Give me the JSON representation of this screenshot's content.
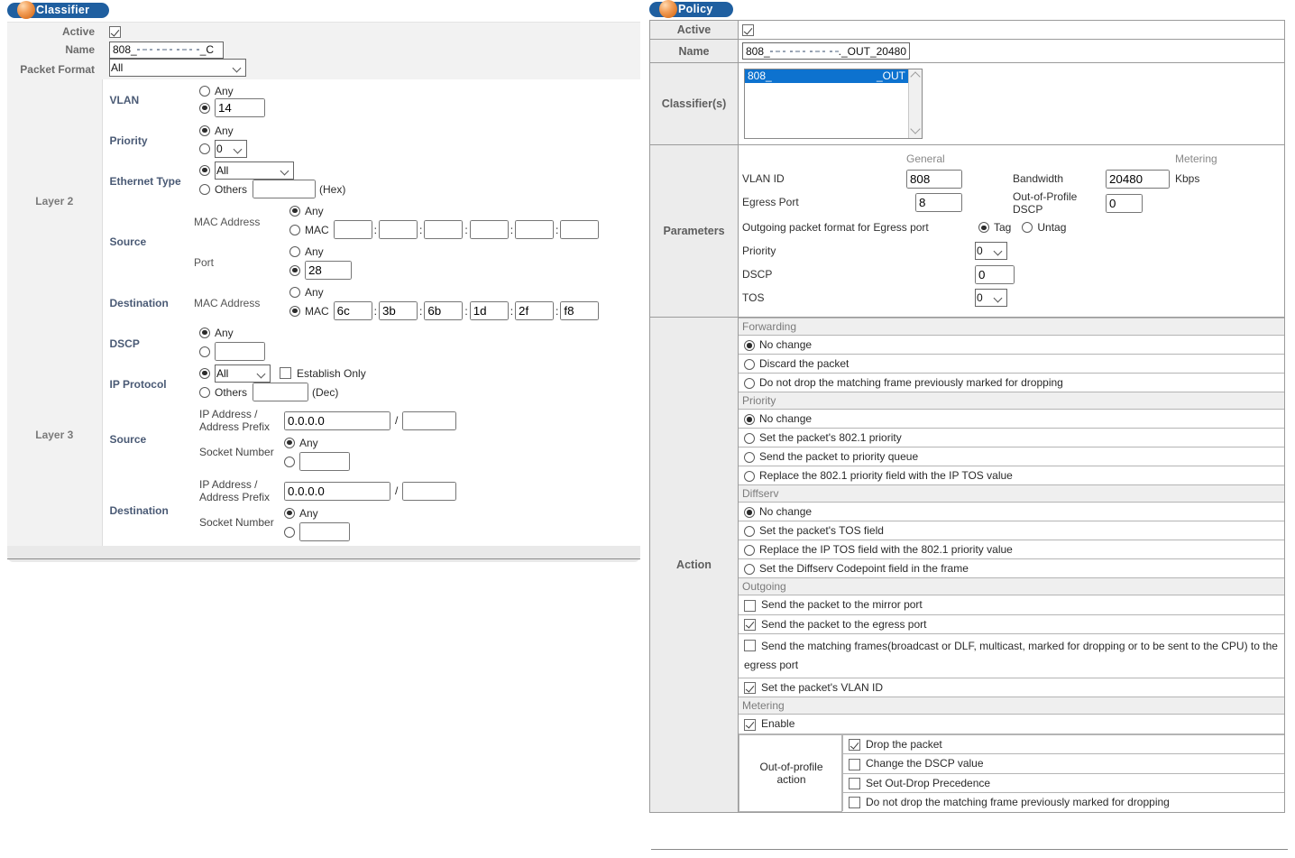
{
  "classifier": {
    "title": "Classifier",
    "active_label": "Active",
    "active_checked": true,
    "name_label": "Name",
    "name_prefix": "808_",
    "name_suffix": "_C",
    "packet_format_label": "Packet Format",
    "packet_format_value": "All",
    "layer2_label": "Layer 2",
    "layer3_label": "Layer 3",
    "vlan_label": "VLAN",
    "vlan_any_label": "Any",
    "vlan_value": "14",
    "priority_label": "Priority",
    "priority_any_label": "Any",
    "priority_value": "0",
    "ethertype_label": "Ethernet Type",
    "ethertype_value": "All",
    "others_label": "Others",
    "hex_note": "(Hex)",
    "dec_note": "(Dec)",
    "source_label": "Source",
    "destination_label": "Destination",
    "mac_address_label": "MAC Address",
    "mac_label": "MAC",
    "any_label": "Any",
    "port_label": "Port",
    "src_port_value": "28",
    "dst_mac": [
      "6c",
      "3b",
      "6b",
      "1d",
      "2f",
      "f8"
    ],
    "src_mac": [
      "",
      "",
      "",
      "",
      "",
      ""
    ],
    "dscp_label": "DSCP",
    "dscp_value": "",
    "ip_protocol_label": "IP Protocol",
    "ip_protocol_value": "All",
    "establish_only_label": "Establish Only",
    "ip_proto_others_value": "",
    "ip_addr_label": "IP Address /",
    "addr_prefix_label": "Address Prefix",
    "src_ip": "0.0.0.0",
    "src_prefix": "",
    "dst_ip": "0.0.0.0",
    "dst_prefix": "",
    "socket_number_label": "Socket Number",
    "src_socket": "",
    "dst_socket": ""
  },
  "policy": {
    "title": "Policy",
    "active_label": "Active",
    "active_checked": true,
    "name_label": "Name",
    "name_prefix": "808_",
    "name_suffix": "._OUT_20480",
    "classifiers_label": "Classifier(s)",
    "classifier_option_prefix": "808_",
    "classifier_option_suffix": "_OUT",
    "parameters_label": "Parameters",
    "general_header": "General",
    "metering_header": "Metering",
    "vlan_id_label": "VLAN ID",
    "vlan_id_value": "808",
    "egress_port_label": "Egress Port",
    "egress_port_value": "8",
    "bandwidth_label": "Bandwidth",
    "bandwidth_value": "20480",
    "bandwidth_unit": "Kbps",
    "oop_dscp_label_1": "Out-of-Profile",
    "oop_dscp_label_2": "DSCP",
    "oop_dscp_value": "0",
    "outgoing_format_label": "Outgoing packet format for Egress port",
    "tag_label": "Tag",
    "untag_label": "Untag",
    "priority_label": "Priority",
    "priority_value": "0",
    "dscp_label": "DSCP",
    "dscp_value": "0",
    "tos_label": "TOS",
    "tos_value": "0",
    "action_label": "Action",
    "groups": {
      "forwarding": "Forwarding",
      "priority": "Priority",
      "diffserv": "Diffserv",
      "outgoing": "Outgoing",
      "metering": "Metering"
    },
    "forwarding_options": [
      {
        "label": "No change",
        "selected": true
      },
      {
        "label": "Discard the packet",
        "selected": false
      },
      {
        "label": "Do not drop the matching frame previously marked for dropping",
        "selected": false
      }
    ],
    "priority_options": [
      {
        "label": "No change",
        "selected": true
      },
      {
        "label": "Set the packet's 802.1 priority",
        "selected": false
      },
      {
        "label": "Send the packet to priority queue",
        "selected": false
      },
      {
        "label": "Replace the 802.1 priority field with the IP TOS value",
        "selected": false
      }
    ],
    "diffserv_options": [
      {
        "label": "No change",
        "selected": true
      },
      {
        "label": "Set the packet's TOS field",
        "selected": false
      },
      {
        "label": "Replace the IP TOS field with the 802.1 priority value",
        "selected": false
      },
      {
        "label": "Set the Diffserv Codepoint field in the frame",
        "selected": false
      }
    ],
    "outgoing_options": [
      {
        "label": "Send the packet to the mirror port",
        "checked": false
      },
      {
        "label": "Send the packet to the egress port",
        "checked": true
      },
      {
        "label": "Send the matching frames(broadcast or DLF, multicast, marked for dropping or to be sent to the CPU) to the egress port",
        "checked": true
      },
      {
        "label": "Set the packet's VLAN ID",
        "checked": true
      }
    ],
    "metering_enable": {
      "label": "Enable",
      "checked": true
    },
    "oop_action_label": "Out-of-profile action",
    "oop_action_options": [
      {
        "label": "Drop the packet",
        "checked": true
      },
      {
        "label": "Change the DSCP value",
        "checked": false
      },
      {
        "label": "Set Out-Drop Precedence",
        "checked": false
      },
      {
        "label": "Do not drop the matching frame previously marked for dropping",
        "checked": false
      }
    ]
  },
  "colors": {
    "title_bar": "#1f5fa0",
    "orb": "#e8893f",
    "selection": "#0d72cf",
    "label_text": "#6b6b6b"
  }
}
